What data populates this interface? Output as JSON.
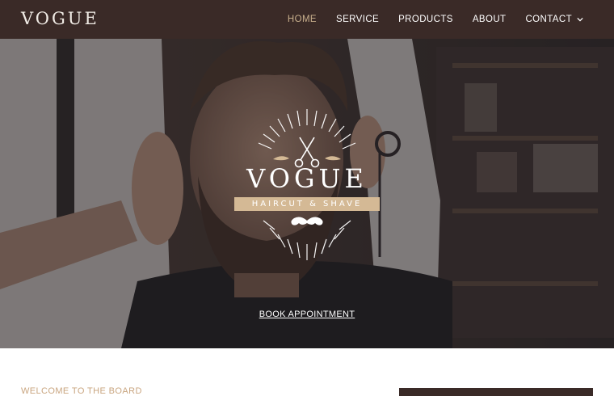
{
  "header": {
    "logo": "VOGUE",
    "nav": [
      {
        "label": "HOME",
        "active": true
      },
      {
        "label": "SERVICE",
        "active": false
      },
      {
        "label": "PRODUCTS",
        "active": false
      },
      {
        "label": "ABOUT",
        "active": false
      },
      {
        "label": "CONTACT",
        "active": false,
        "has_dropdown": true
      }
    ]
  },
  "hero": {
    "brand": "VOGUE",
    "tagline": "HAIRCUT & SHAVE",
    "cta_label": "BOOK APPOINTMENT",
    "icons": [
      "scissors-icon",
      "mustache-icon"
    ]
  },
  "welcome": {
    "eyebrow": "WELCOME TO THE BOARD"
  },
  "colors": {
    "header_bg": "#3a2a27",
    "accent": "#c9b08d",
    "ribbon": "#d4b995",
    "eyebrow": "#c9a57f"
  }
}
